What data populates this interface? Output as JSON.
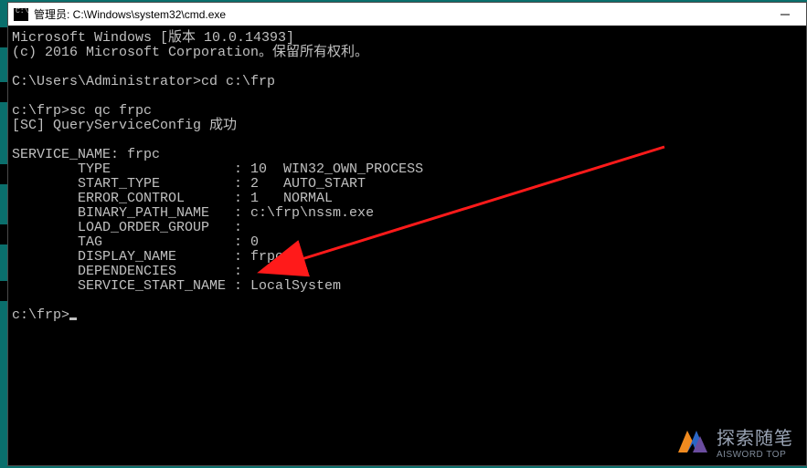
{
  "window": {
    "title": "管理员: C:\\Windows\\system32\\cmd.exe"
  },
  "terminal": {
    "line1": "Microsoft Windows [版本 10.0.14393]",
    "line2": "(c) 2016 Microsoft Corporation。保留所有权利。",
    "blank1": "",
    "prompt1": "C:\\Users\\Administrator>cd c:\\frp",
    "blank2": "",
    "prompt2": "c:\\frp>sc qc frpc",
    "qsc": "[SC] QueryServiceConfig 成功",
    "blank3": "",
    "svc_name": "SERVICE_NAME: frpc",
    "type": "        TYPE               : 10  WIN32_OWN_PROCESS",
    "start_type": "        START_TYPE         : 2   AUTO_START",
    "err_ctrl": "        ERROR_CONTROL      : 1   NORMAL",
    "bin_path": "        BINARY_PATH_NAME   : c:\\frp\\nssm.exe",
    "load_grp": "        LOAD_ORDER_GROUP   :",
    "tag": "        TAG                : 0",
    "disp_name": "        DISPLAY_NAME       : frpc",
    "deps": "        DEPENDENCIES       :",
    "start_name": "        SERVICE_START_NAME : LocalSystem",
    "blank4": "",
    "prompt3_prefix": "c:\\frp>"
  },
  "watermark": {
    "text": "探索随笔",
    "sub": "AISWORD TOP"
  }
}
